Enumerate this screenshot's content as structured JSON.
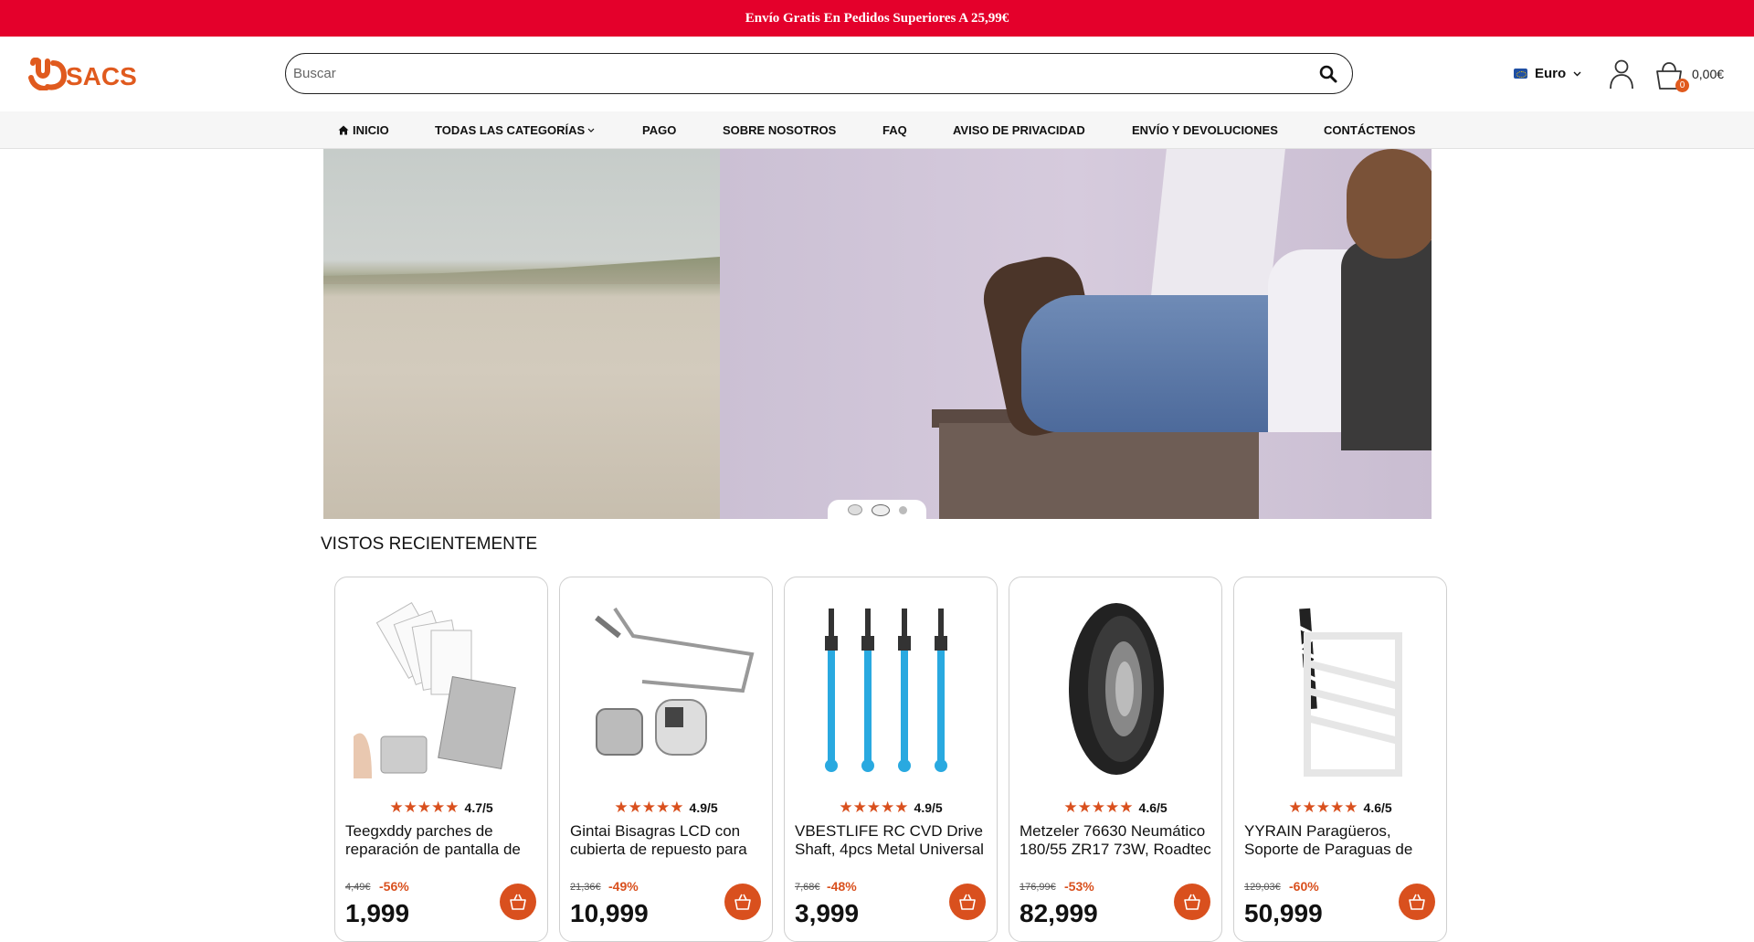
{
  "topbar": {
    "text": "Envío Gratis En Pedidos Superiores A 25,99€"
  },
  "header": {
    "logo_text": "SACS",
    "search": {
      "placeholder": "Buscar",
      "value": ""
    },
    "currency": "Euro",
    "cart_count": "0",
    "cart_total": "0,00€"
  },
  "nav": {
    "items": [
      {
        "label": "INICIO",
        "icon": "home-icon"
      },
      {
        "label": "TODAS LAS CATEGORÍAS",
        "icon": "chevron-down-icon"
      },
      {
        "label": "PAGO"
      },
      {
        "label": "SOBRE NOSOTROS"
      },
      {
        "label": "FAQ"
      },
      {
        "label": "AVISO DE PRIVACIDAD"
      },
      {
        "label": "ENVÍO Y DEVOLUCIONES"
      },
      {
        "label": "CONTÁCTENOS"
      }
    ]
  },
  "slider": {
    "slide_count": 3,
    "active_index": 1
  },
  "recent": {
    "title": "VISTOS RECIENTEMENTE",
    "products": [
      {
        "rating": "4.7/5",
        "rating_value": 4.7,
        "title": "Teegxddy parches de reparación de pantalla de",
        "old_price": "4,49€",
        "discount": "-56%",
        "new_price": "1,999"
      },
      {
        "rating": "4.9/5",
        "rating_value": 4.9,
        "title": "Gintai Bisagras LCD con cubierta de repuesto para",
        "old_price": "21,36€",
        "discount": "-49%",
        "new_price": "10,999"
      },
      {
        "rating": "4.9/5",
        "rating_value": 4.9,
        "title": "VBESTLIFE RC CVD Drive Shaft, 4pcs Metal Universal",
        "old_price": "7,68€",
        "discount": "-48%",
        "new_price": "3,999"
      },
      {
        "rating": "4.6/5",
        "rating_value": 4.6,
        "title": "Metzeler 76630 Neumático 180/55 ZR17 73W, Roadtec",
        "old_price": "176,99€",
        "discount": "-53%",
        "new_price": "82,999"
      },
      {
        "rating": "4.6/5",
        "rating_value": 4.6,
        "title": "YYRAIN Paragüeros, Soporte de Paraguas de",
        "old_price": "129,03€",
        "discount": "-60%",
        "new_price": "50,999"
      }
    ]
  },
  "colors": {
    "accent": "#e4002b",
    "brand": "#e05a1e",
    "rating": "#d9501e"
  }
}
